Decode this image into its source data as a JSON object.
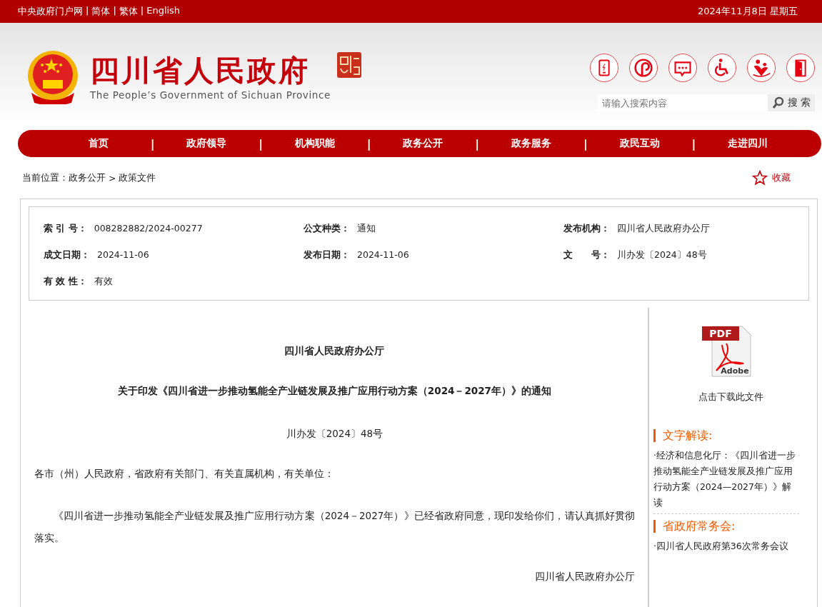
{
  "top_bar": {
    "links": [
      "中央政府门户网",
      "简体",
      "繁体",
      "English"
    ],
    "separator": "|",
    "date": "2024年11月8日 星期五"
  },
  "header": {
    "title": "四川省人民政府",
    "subtitle": "The People’s Government of Sichuan Province",
    "tools": [
      {
        "kind": "phone"
      },
      {
        "kind": "pin"
      },
      {
        "kind": "chat"
      },
      {
        "kind": "wheelchair"
      },
      {
        "kind": "care"
      },
      {
        "kind": "door"
      }
    ],
    "search": {
      "placeholder": "请输入搜索内容",
      "button": "搜 索"
    }
  },
  "nav": {
    "items": [
      "首页",
      "政府领导",
      "机构职能",
      "政务公开",
      "政务服务",
      "政民互动",
      "走进四川"
    ],
    "separator": "|"
  },
  "breadcrumb": {
    "prefix": "当前位置：",
    "items": [
      "政务公开",
      "政策文件"
    ],
    "separator": ">",
    "favorite": "收藏"
  },
  "meta": [
    [
      {
        "label": "索 引 号：",
        "value": "008282882/2024-00277"
      },
      {
        "label": "公文种类：",
        "value": "通知"
      },
      {
        "label": "发布机构：",
        "value": "四川省人民政府办公厅"
      }
    ],
    [
      {
        "label": "成文日期：",
        "value": "2024-11-06"
      },
      {
        "label": "发布日期：",
        "value": "2024-11-06"
      },
      {
        "label": "文　　号：",
        "value": "川办发〔2024〕48号"
      }
    ],
    [
      {
        "label": "有 效 性：",
        "value": "有效"
      }
    ]
  ],
  "document": {
    "issuer": "四川省人民政府办公厅",
    "title": "关于印发《四川省进一步推动氢能全产业链发展及推广应用行动方案（2024－2027年）》的通知",
    "number": "川办发〔2024〕48号",
    "salutation": "各市（州）人民政府，省政府有关部门、有关直属机构，有关单位：",
    "paragraph": "《四川省进一步推动氢能全产业链发展及推广应用行动方案（2024－2027年）》已经省政府同意，现印发给你们，请认真抓好贯彻落实。",
    "signature": "四川省人民政府办公厅"
  },
  "sidebar": {
    "pdf_badge": "PDF",
    "pdf_brand": "Adobe",
    "download": "点击下载此文件",
    "sections": [
      {
        "heading": "文字解读:",
        "items": [
          "·经济和信息化厅：《四川省进一步推动氢能全产业链发展及推广应用行动方案（2024—2027年）》解读"
        ]
      },
      {
        "heading": "省政府常务会:",
        "items": [
          "·四川省人民政府第36次常务会议"
        ]
      }
    ]
  }
}
